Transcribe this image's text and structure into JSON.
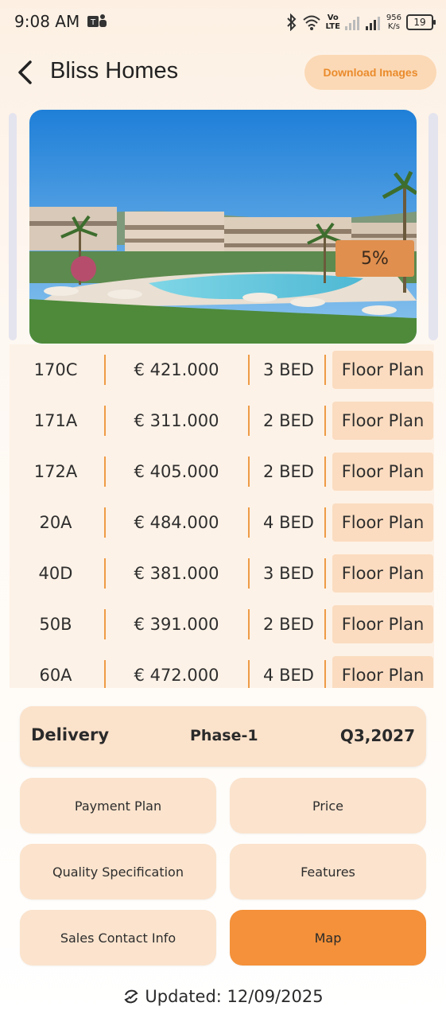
{
  "status_bar": {
    "time": "9:08 AM",
    "net_speed_value": "956",
    "net_speed_unit": "K/s",
    "network_label_top": "Vo",
    "network_label_bottom": "LTE",
    "battery": "19",
    "icons": [
      "teams-icon",
      "bluetooth-icon",
      "wifi-icon",
      "signal-icon",
      "signal-icon",
      "battery-icon"
    ]
  },
  "header": {
    "title": "Bliss Homes",
    "download_label": "Download Images"
  },
  "carousel": {
    "badge": "5%"
  },
  "units": [
    {
      "id": "170C",
      "price": "€ 421.000",
      "beds": "3 BED",
      "plan": "Floor Plan"
    },
    {
      "id": "171A",
      "price": "€ 311.000",
      "beds": "2 BED",
      "plan": "Floor Plan"
    },
    {
      "id": "172A",
      "price": "€ 405.000",
      "beds": "2 BED",
      "plan": "Floor Plan"
    },
    {
      "id": "20A",
      "price": "€ 484.000",
      "beds": "4 BED",
      "plan": "Floor Plan"
    },
    {
      "id": "40D",
      "price": "€ 381.000",
      "beds": "3 BED",
      "plan": "Floor Plan"
    },
    {
      "id": "50B",
      "price": "€ 391.000",
      "beds": "2 BED",
      "plan": "Floor Plan"
    },
    {
      "id": "60A",
      "price": "€ 472.000",
      "beds": "4 BED",
      "plan": "Floor Plan"
    }
  ],
  "delivery": {
    "label": "Delivery",
    "phase": "Phase-1",
    "date": "Q3,2027"
  },
  "actions": {
    "payment_plan": "Payment Plan",
    "price": "Price",
    "quality_specification": "Quality Specification",
    "features": "Features",
    "sales_contact": "Sales Contact Info",
    "map": "Map"
  },
  "footer": {
    "updated": "Updated: 12/09/2025"
  },
  "colors": {
    "accent": "#f4913a",
    "button_bg": "#fbe3cd",
    "separator": "#ee9b45",
    "download_text": "#ea8b2c"
  }
}
